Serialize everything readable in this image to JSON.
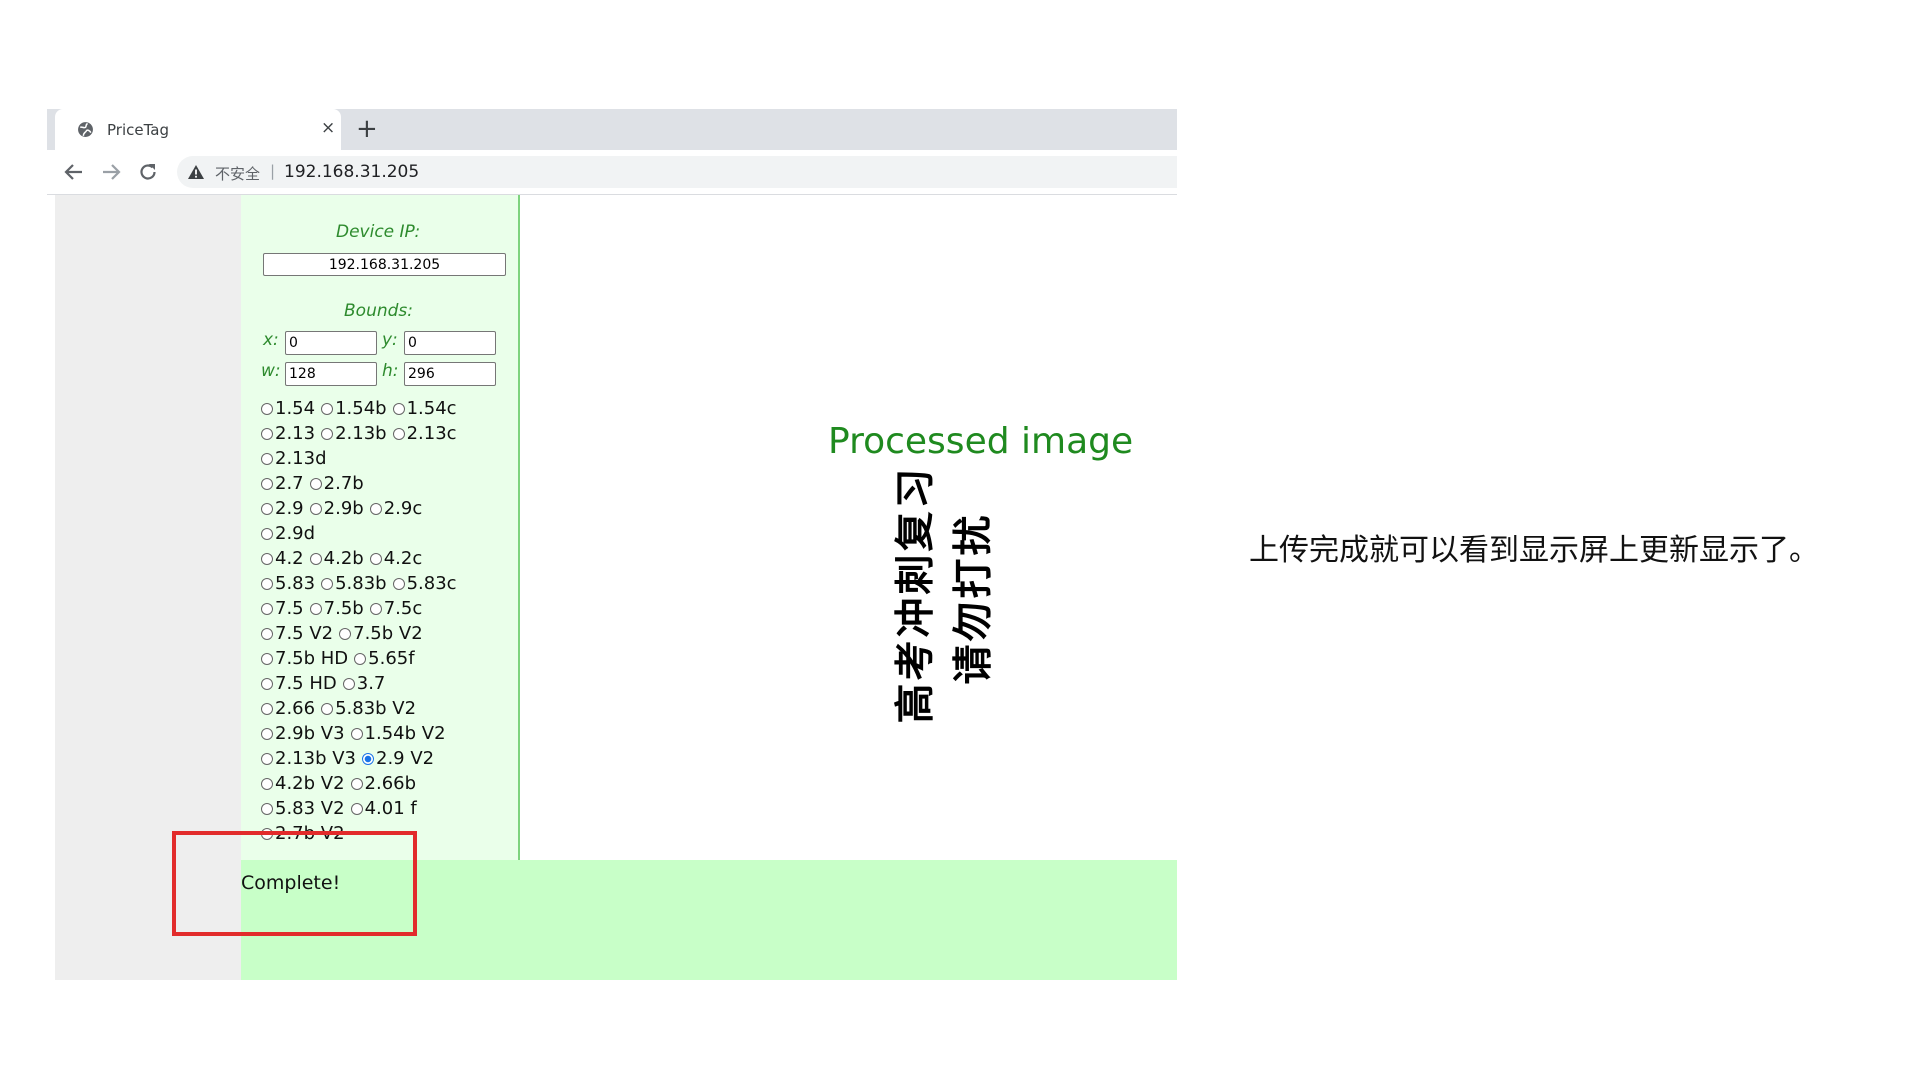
{
  "browser": {
    "tab_title": "PriceTag",
    "tab_close": "×",
    "new_tab": "+",
    "security_label": "不安全",
    "separator": "|",
    "url": "192.168.31.205"
  },
  "panel": {
    "device_ip_label": "Device IP:",
    "device_ip_value": "192.168.31.205",
    "bounds_label": "Bounds:",
    "x_label": "x:",
    "x_value": "0",
    "y_label": "y:",
    "y_value": "0",
    "w_label": "w:",
    "w_value": "128",
    "h_label": "h:",
    "h_value": "296",
    "display_options": [
      [
        "1.54",
        "1.54b",
        "1.54c"
      ],
      [
        "2.13",
        "2.13b",
        "2.13c"
      ],
      [
        "2.13d"
      ],
      [
        "2.7",
        "2.7b"
      ],
      [
        "2.9",
        "2.9b",
        "2.9c"
      ],
      [
        "2.9d"
      ],
      [
        "4.2",
        "4.2b",
        "4.2c"
      ],
      [
        "5.83",
        "5.83b",
        "5.83c"
      ],
      [
        "7.5",
        "7.5b",
        "7.5c"
      ],
      [
        "7.5 V2",
        "7.5b V2"
      ],
      [
        "7.5b HD",
        "5.65f"
      ],
      [
        "7.5 HD",
        "3.7"
      ],
      [
        "2.66",
        "5.83b V2"
      ],
      [
        "2.9b V3",
        "1.54b V2"
      ],
      [
        "2.13b V3",
        "2.9 V2"
      ],
      [
        "4.2b V2",
        "2.66b"
      ],
      [
        "5.83 V2",
        "4.01 f"
      ],
      [
        "2.7b V2"
      ]
    ],
    "selected_option": "2.9 V2"
  },
  "processed": {
    "title": "Processed image",
    "line1": "高考冲刺复习",
    "line2": "请勿打扰"
  },
  "status": {
    "text": "Complete!"
  },
  "caption": "上传完成就可以看到显示屏上更新显示了。",
  "colors": {
    "panel_bg": "#eaffea",
    "status_bg": "#c8ffc8",
    "label_green": "#2e8b2e",
    "title_green": "#1f8a1f",
    "highlight_red": "#e22b2b",
    "radio_selected": "#1a73e8"
  },
  "icons": [
    "globe-icon",
    "close-icon",
    "plus-icon",
    "back-arrow-icon",
    "forward-arrow-icon",
    "reload-icon",
    "warning-icon"
  ]
}
